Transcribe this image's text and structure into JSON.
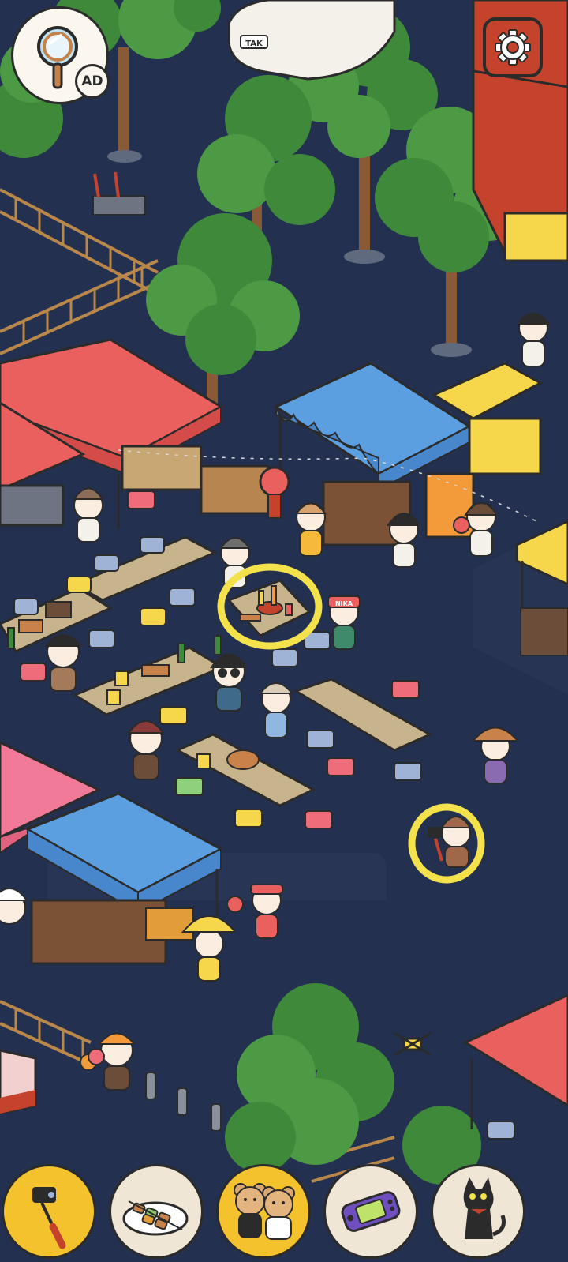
{
  "game": {
    "hint_button": {
      "icon": "magnifier-icon",
      "badge_text": "AD"
    },
    "settings_button": {
      "icon": "gear-icon"
    },
    "scene": {
      "name": "night-market",
      "car_plate": "TAK",
      "vendor_cap_text": "NIKA",
      "found_markers": [
        {
          "name": "found-marker-hotpot-skewers",
          "color": "#f4e24c"
        },
        {
          "name": "found-marker-selfie-stick",
          "color": "#f4e24c"
        }
      ]
    },
    "item_tray": [
      {
        "icon": "selfie-stick-icon",
        "found": true
      },
      {
        "icon": "grilled-skewers-icon",
        "found": false
      },
      {
        "icon": "teddy-bear-couple-icon",
        "found": true
      },
      {
        "icon": "handheld-console-icon",
        "found": false
      },
      {
        "icon": "black-cat-icon",
        "found": false
      }
    ],
    "colors": {
      "ground": "#24304f",
      "tray_found": "#f4c22c",
      "tray_default": "#efe6d6",
      "marker": "#f4e24c",
      "canopy_red": "#e9605e",
      "canopy_blue": "#5b9fe0",
      "canopy_yellow": "#f6d64a"
    }
  }
}
